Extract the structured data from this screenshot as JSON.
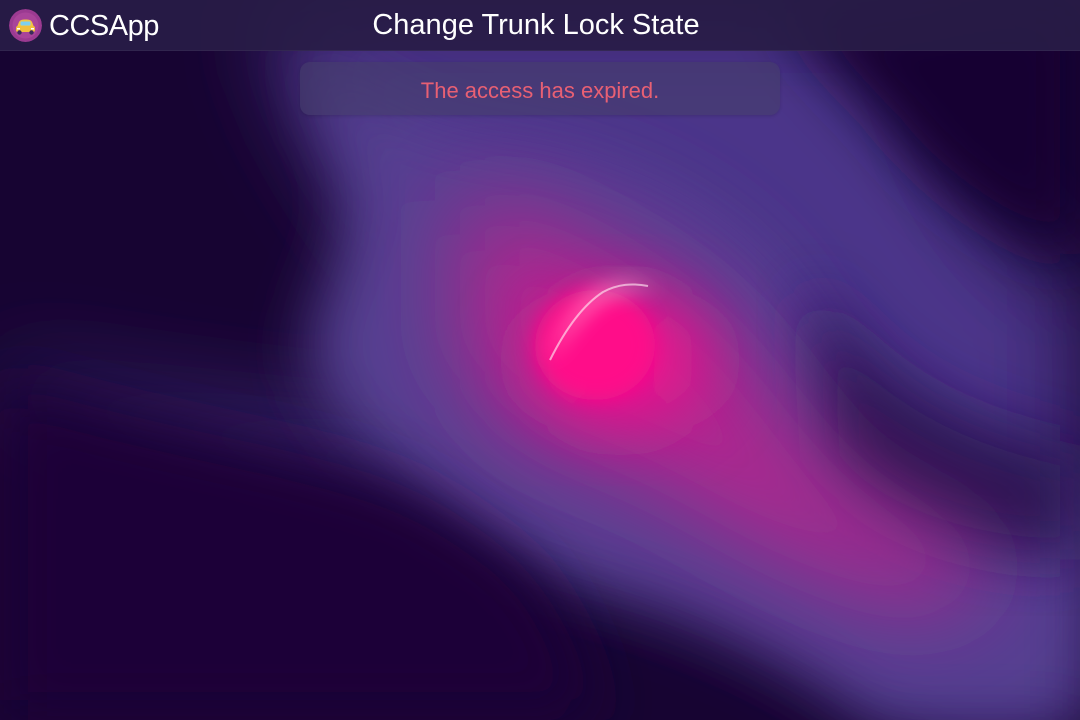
{
  "app": {
    "name": "CCSApp",
    "logo_icon": "car-logo-icon"
  },
  "header": {
    "title": "Change Trunk Lock State"
  },
  "message": {
    "text": "The access has expired.",
    "color": "#e86073"
  },
  "theme": {
    "background": "#180536",
    "accent_purple": "#553f92",
    "accent_pink": "#ff0b8c"
  }
}
